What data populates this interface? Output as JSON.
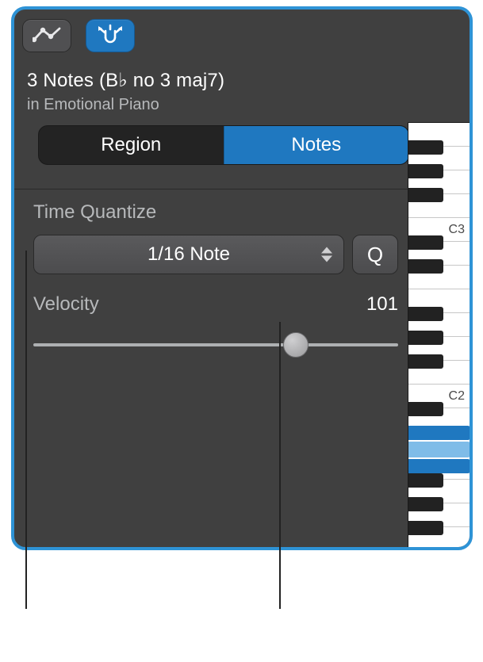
{
  "header": {
    "title": "3 Notes (B♭ no 3 maj7)",
    "subtitle": "in Emotional Piano"
  },
  "tabs": {
    "region": "Region",
    "notes": "Notes",
    "active": "notes"
  },
  "quantize": {
    "label": "Time Quantize",
    "value": "1/16 Note",
    "button": "Q"
  },
  "velocity": {
    "label": "Velocity",
    "value": "101",
    "percent": 0.72
  },
  "piano": {
    "labels": [
      "C3",
      "C2"
    ],
    "highlight_colors": {
      "sustained": "#1f78c0",
      "selected": "#7fbce8"
    }
  },
  "icons": {
    "automation": "automation-icon",
    "catch": "mute-tool-icon"
  }
}
